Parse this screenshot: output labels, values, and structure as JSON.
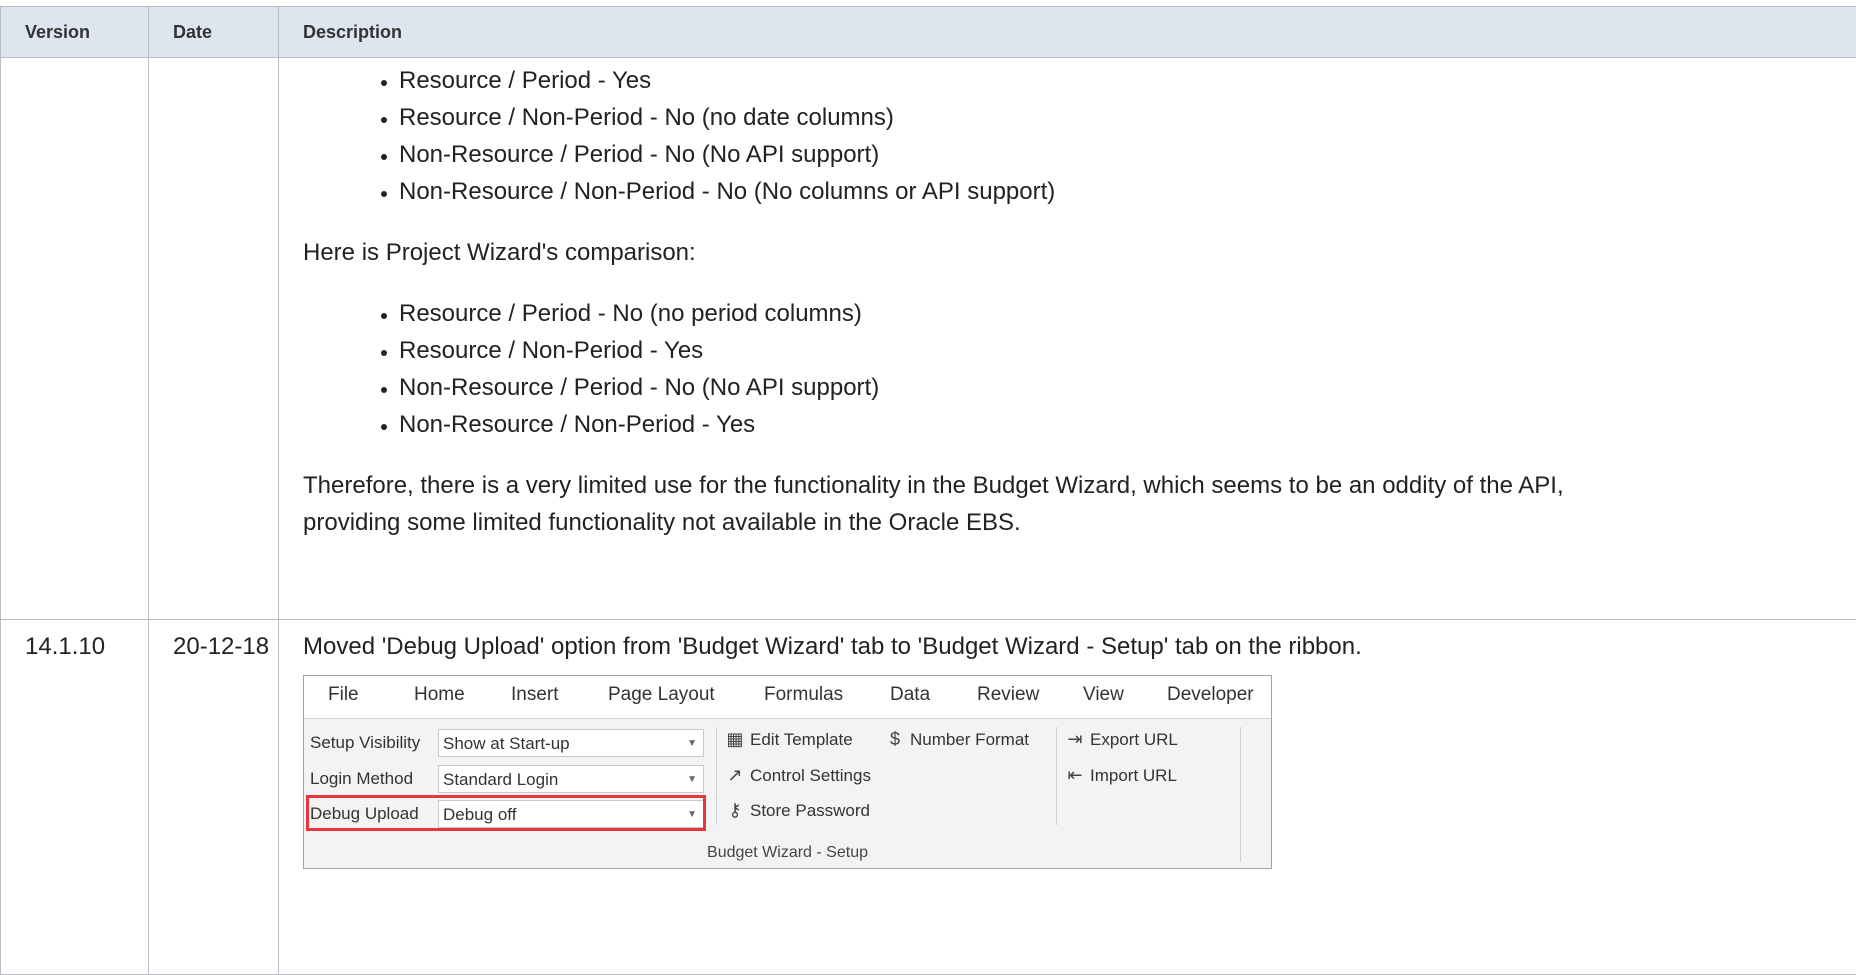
{
  "table": {
    "headers": {
      "version": "Version",
      "date": "Date",
      "description": "Description"
    },
    "row1": {
      "version": "",
      "date": "",
      "bullets_a": [
        "Resource / Period - Yes",
        "Resource / Non-Period - No (no date columns)",
        "Non-Resource / Period - No (No API support)",
        "Non-Resource / Non-Period - No (No columns or API support)"
      ],
      "paragraph_a": "Here is Project Wizard's comparison:",
      "bullets_b": [
        "Resource / Period - No (no period columns)",
        "Resource / Non-Period - Yes",
        "Non-Resource / Period - No (No API support)",
        "Non-Resource / Non-Period - Yes"
      ],
      "paragraph_b_line1": "Therefore, there is a very limited use for the functionality in the Budget Wizard, which seems to be an oddity of the API,",
      "paragraph_b_line2": "providing some limited functionality not available in the Oracle EBS."
    },
    "row2": {
      "version": "14.1.10",
      "date": "20-12-18",
      "description": "Moved 'Debug Upload' option from 'Budget Wizard' tab to 'Budget Wizard - Setup' tab on the ribbon."
    }
  },
  "ribbon": {
    "tabs": [
      "File",
      "Home",
      "Insert",
      "Page Layout",
      "Formulas",
      "Data",
      "Review",
      "View",
      "Developer"
    ],
    "fields": [
      {
        "label": "Setup Visibility",
        "value": "Show at Start-up"
      },
      {
        "label": "Login Method",
        "value": "Standard Login"
      },
      {
        "label": "Debug Upload",
        "value": "Debug off"
      }
    ],
    "buttons": {
      "edit_template": "Edit Template",
      "control_settings": "Control Settings",
      "store_password": "Store Password",
      "number_format": "Number Format",
      "export_url": "Export URL",
      "import_url": "Import URL"
    },
    "icons": {
      "edit_template": "template-icon",
      "control_settings": "wrench-icon",
      "store_password": "key-icon",
      "number_format": "dollar-icon",
      "export_url": "export-icon",
      "import_url": "import-icon",
      "dropdown": "chevron-down-icon"
    },
    "group_name": "Budget Wizard - Setup",
    "highlight_color": "#e8363f"
  }
}
